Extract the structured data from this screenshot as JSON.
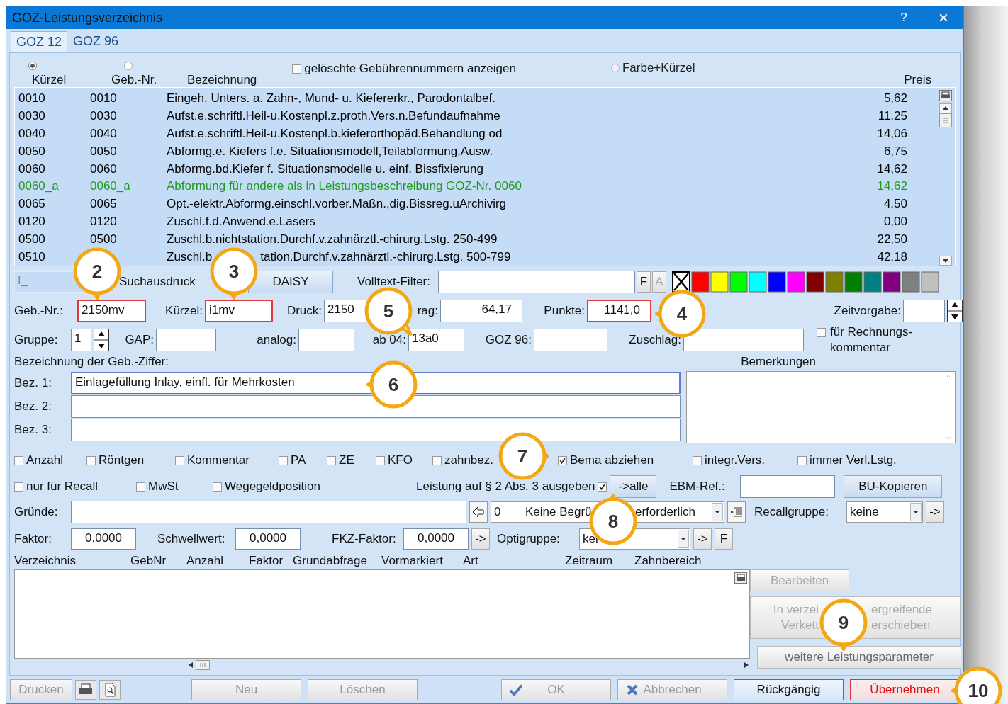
{
  "window": {
    "title": "GOZ-Leistungsverzeichnis",
    "help": "?",
    "close": "×"
  },
  "tabs": [
    {
      "label": "GOZ 12",
      "selected": true
    },
    {
      "label": "GOZ 96",
      "selected": false
    }
  ],
  "list_header": {
    "sort_options": [
      {
        "label": "Kürzel",
        "selected": true
      },
      {
        "label": "Geb.-Nr.",
        "selected": false
      }
    ],
    "name_column": "Bezeichnung",
    "price_column": "Preis",
    "show_deleted": {
      "label": "gelöschte Gebührennummern anzeigen",
      "checked": false
    },
    "color_option": {
      "label": "Farbe+Kürzel",
      "selected": false
    }
  },
  "rows": [
    {
      "code": "0010",
      "geb_nr": "0010",
      "name": "Eingeh. Unters. a. Zahn-, Mund- u. Kiefererkr., Parodontalbef.",
      "price": "5,62",
      "color": "#000000"
    },
    {
      "code": "0030",
      "geb_nr": "0030",
      "name": "Aufst.e.schriftl.Heil-u.Kostenpl.z.proth.Vers.n.Befundaufnahme",
      "price": "11,25",
      "color": "#000000"
    },
    {
      "code": "0040",
      "geb_nr": "0040",
      "name": "Aufst.e.schriftl.Heil-u.Kostenpl.b.kieferorthopäd.Behandlung od",
      "price": "14,06",
      "color": "#000000"
    },
    {
      "code": "0050",
      "geb_nr": "0050",
      "name": "Abformg.e. Kiefers  f.e. Situationsmodell,Teilabformung,Ausw.",
      "price": "6,75",
      "color": "#000000"
    },
    {
      "code": "0060",
      "geb_nr": "0060",
      "name": "Abformg.bd.Kiefer f. Situationsmodelle u. einf. Bissfixierung",
      "price": "14,62",
      "color": "#000000"
    },
    {
      "code": "0060_a",
      "geb_nr": "0060_a",
      "name": "Abformung für andere als in Leistungsbeschreibung GOZ-Nr. 0060",
      "price": "14,62",
      "color": "#1f9a1f"
    },
    {
      "code": "0065",
      "geb_nr": "0065",
      "name": "Opt.-elektr.Abformg.einschl.vorber.Maßn.,dig.Bissreg.uArchivirg",
      "price": "4,50",
      "color": "#000000"
    },
    {
      "code": "0120",
      "geb_nr": "0120",
      "name": "Zuschl.f.d.Anwend.e.Lasers",
      "price": "0,00",
      "color": "#000000"
    },
    {
      "code": "0500",
      "geb_nr": "0500",
      "name": "Zuschl.b.nichtstation.Durchf.v.zahnärztl.-chirurg.Lstg. 250-499",
      "price": "22,50",
      "color": "#000000"
    },
    {
      "code": "0510",
      "name_parts": [
        "Zuschl.b",
        "tation.Durchf.v.zahnärztl.-chirurg.Lstg. 500-799"
      ],
      "price": "42,18",
      "color": "#000000"
    }
  ],
  "search": {
    "placeholder": "f_",
    "print_button": "Suchausdruck",
    "daisy_button": "DAISY",
    "filter_label": "Volltext-Filter:",
    "filter_buttons": [
      {
        "label": "F",
        "disabled": false
      },
      {
        "label": "A",
        "disabled": true
      }
    ]
  },
  "swatches": [
    {
      "color": "#ffffff",
      "selected": true
    },
    {
      "color": "#ff0000",
      "selected": false
    },
    {
      "color": "#ffff00",
      "selected": false
    },
    {
      "color": "#00ff00",
      "selected": false
    },
    {
      "color": "#00ffff",
      "selected": false
    },
    {
      "color": "#0000ff",
      "selected": false
    },
    {
      "color": "#ff00ff",
      "selected": false
    },
    {
      "color": "#800000",
      "selected": false
    },
    {
      "color": "#808000",
      "selected": false
    },
    {
      "color": "#008000",
      "selected": false
    },
    {
      "color": "#008080",
      "selected": false
    },
    {
      "color": "#800080",
      "selected": false
    },
    {
      "color": "#808080",
      "selected": false
    },
    {
      "color": "#c0c0c0",
      "selected": false
    }
  ],
  "fields_row1": [
    {
      "label": "Geb.-Nr.:",
      "value": "2150mv",
      "highlighted": true,
      "kind": "text"
    },
    {
      "label": "Kürzel:",
      "value": "i1mv",
      "highlighted": true,
      "kind": "text"
    },
    {
      "label": "Druck:",
      "value": "2150",
      "highlighted": false,
      "kind": "text"
    },
    {
      "label": "rag:",
      "value": "64,17",
      "highlighted": false,
      "kind": "number"
    },
    {
      "label": "Punkte:",
      "value": "1141,0",
      "highlighted": true,
      "kind": "number"
    },
    {
      "label": "Zeitvorgabe:",
      "highlighted": false,
      "kind": "spinner"
    }
  ],
  "fields_row2": [
    {
      "label": "Gruppe:",
      "value": "1",
      "highlighted": false,
      "kind": "spinner"
    },
    {
      "label": "GAP:",
      "highlighted": false,
      "kind": "text"
    },
    {
      "label": "analog:",
      "highlighted": false,
      "kind": "text"
    },
    {
      "label": "ab 04:",
      "value": "13a0",
      "highlighted": false,
      "kind": "text"
    },
    {
      "label": "GOZ 96:",
      "highlighted": false,
      "kind": "text"
    },
    {
      "label": "Zuschlag:",
      "highlighted": false,
      "kind": "text"
    }
  ],
  "invoice_comment": {
    "label": "für Rechnungs-kommentar",
    "checked": false
  },
  "description": {
    "title": "Bezeichnung der Geb.-Ziffer:",
    "lines": [
      {
        "label": "Bez. 1:",
        "value": "Einlagefüllung Inlay, einfl. für Mehrkosten",
        "highlighted": true
      },
      {
        "label": "Bez. 2:",
        "highlighted": false
      },
      {
        "label": "Bez. 3:",
        "highlighted": false
      }
    ],
    "remarks_title": "Bemerkungen"
  },
  "options_row1": [
    {
      "label": "Anzahl",
      "checked": false
    },
    {
      "label": "Röntgen",
      "checked": false
    },
    {
      "label": "Kommentar",
      "checked": false
    },
    {
      "label": "PA",
      "checked": false
    },
    {
      "label": "ZE",
      "checked": false
    },
    {
      "label": "KFO",
      "checked": false
    },
    {
      "label": "zahnbez.",
      "checked": false
    },
    {
      "label": "Bema abziehen",
      "checked": true
    },
    {
      "label": "integr.Vers.",
      "checked": false
    },
    {
      "label": "immer Verl.Lstg.",
      "checked": false
    }
  ],
  "options_row2": [
    {
      "label": "nur für Recall",
      "checked": false
    },
    {
      "label": "MwSt",
      "checked": false
    },
    {
      "label": "Wegegeldposition",
      "checked": false
    }
  ],
  "section2": {
    "label": "Leistung auf § 2 Abs. 3 ausgeben",
    "checked": true,
    "all_button": "->alle",
    "ebm_label": "EBM-Ref.:",
    "bu_button": "BU-Kopieren"
  },
  "reasons": {
    "label": "Gründe:",
    "code": "0",
    "text_parts": [
      "Keine Begrü",
      "erforderlich"
    ],
    "recall_label": "Recallgruppe:",
    "recall_value": "keine",
    "recall_button": "->"
  },
  "factors": [
    {
      "label": "Faktor:",
      "value": "0,0000"
    },
    {
      "label": "Schwellwert:",
      "value": "0,0000"
    },
    {
      "label": "FKZ-Faktor:",
      "value": "0,0000"
    }
  ],
  "factor_button": "->",
  "opti": {
    "label": "Optigruppe:",
    "value": "kei",
    "buttons": [
      "->",
      "F"
    ]
  },
  "table_columns": [
    "Verzeichnis",
    "GebNr",
    "Anzahl",
    "Faktor",
    "Grundabfrage",
    "Vormarkiert",
    "Art",
    "Zeitraum",
    "Zahnbereich"
  ],
  "side_buttons": [
    {
      "label": "Bearbeiten",
      "disabled": true
    },
    {
      "label_lines": [
        [
          "In verzei",
          "ergreifende"
        ],
        [
          "Verkett",
          "erschieben"
        ]
      ],
      "disabled": true
    },
    {
      "label": "weitere Leistungsparameter",
      "disabled": false
    }
  ],
  "footer": [
    {
      "label": "Drucken",
      "kind": "text",
      "disabled": true
    },
    {
      "kind": "printer",
      "disabled": false
    },
    {
      "kind": "preview",
      "disabled": false
    },
    {
      "label": "Neu",
      "kind": "text",
      "disabled": true
    },
    {
      "label": "Löschen",
      "kind": "text",
      "disabled": true
    },
    {
      "label": "OK",
      "kind": "ok",
      "disabled": true
    },
    {
      "label": "Abbrechen",
      "kind": "cancel",
      "disabled": true
    },
    {
      "label": "Rückgängig",
      "kind": "undo",
      "disabled": false
    },
    {
      "label": "Übernehmen",
      "kind": "apply",
      "disabled": false
    }
  ],
  "callouts": [
    "2",
    "3",
    "4",
    "5",
    "6",
    "7",
    "8",
    "9",
    "10"
  ]
}
